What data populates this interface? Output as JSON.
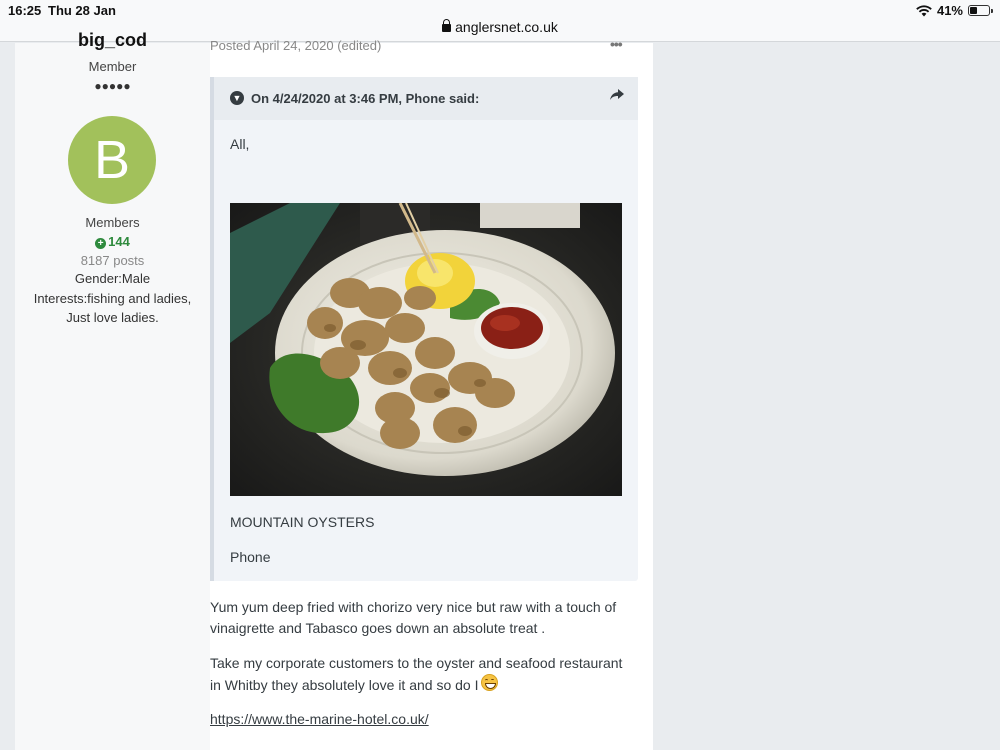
{
  "status_bar": {
    "time": "16:25",
    "date": "Thu 28 Jan",
    "battery": "41%",
    "battery_level": 0.41,
    "wifi_icon": "wifi-icon",
    "url": "anglersnet.co.uk"
  },
  "author": {
    "username": "big_cod",
    "rank": "Member",
    "pips": "●●●●●",
    "avatar_letter": "B",
    "avatar_color": "#a2c15b",
    "group": "Members",
    "reputation": "144",
    "posts": "8187 posts",
    "gender": "Gender:Male",
    "interests": "Interests:fishing and ladies, Just love ladies."
  },
  "post": {
    "meta": "Posted April 24, 2020 (edited)",
    "menu_icon": "•••",
    "quote": {
      "citation": "On 4/24/2020 at 3:46 PM, Phone said:",
      "greeting": "All,",
      "caption": "MOUNTAIN OYSTERS",
      "signature": "Phone"
    },
    "paragraph1": "Yum yum  deep fried with chorizo very nice  but raw with a touch  of  vinaigrette and Tabasco goes down an absolute treat .",
    "paragraph2": " Take my corporate customers to the  oyster and seafood restaurant in Whitby they absolutely love it and so do I",
    "link": "https://www.the-marine-hotel.co.uk/"
  },
  "colors": {
    "accent_green": "#2e8a3d",
    "quote_bg": "#f1f4f8",
    "page_bg": "#e9ecef"
  }
}
